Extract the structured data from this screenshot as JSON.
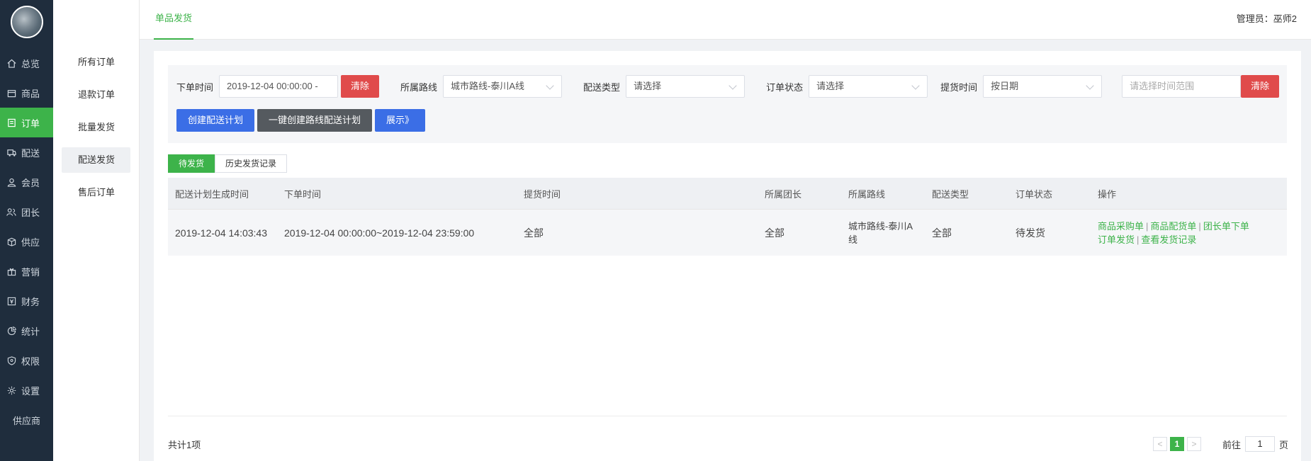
{
  "sidebar": {
    "items": [
      {
        "label": "总览",
        "icon": "home-icon"
      },
      {
        "label": "商品",
        "icon": "box-icon"
      },
      {
        "label": "订单",
        "icon": "order-icon",
        "active": true
      },
      {
        "label": "配送",
        "icon": "truck-icon"
      },
      {
        "label": "会员",
        "icon": "user-icon"
      },
      {
        "label": "团长",
        "icon": "team-icon"
      },
      {
        "label": "供应",
        "icon": "supply-icon"
      },
      {
        "label": "营销",
        "icon": "gift-icon"
      },
      {
        "label": "财务",
        "icon": "finance-icon"
      },
      {
        "label": "统计",
        "icon": "chart-icon"
      },
      {
        "label": "权限",
        "icon": "shield-icon"
      },
      {
        "label": "设置",
        "icon": "gear-icon"
      },
      {
        "label": "供应商",
        "icon": ""
      }
    ]
  },
  "submenu": {
    "items": [
      "所有订单",
      "退款订单",
      "批量发货",
      "配送发货",
      "售后订单"
    ],
    "active_index": 3
  },
  "header": {
    "tab": "单品发货",
    "admin_label": "管理员：",
    "admin_name": "巫师2"
  },
  "filters": {
    "order_time_label": "下单时间",
    "order_time_value": "2019-12-04 00:00:00 -",
    "clear_label": "清除",
    "route_label": "所属路线",
    "route_value": "城市路线-泰川A线",
    "delivery_type_label": "配送类型",
    "delivery_type_value": "请选择",
    "order_status_label": "订单状态",
    "order_status_value": "请选择",
    "pickup_time_label": "提货时间",
    "pickup_time_value": "按日期",
    "pickup_range_placeholder": "请选择时间范围",
    "clear2_label": "清除"
  },
  "actions": {
    "create_plan": "创建配送计划",
    "one_click_plan": "一键创建路线配送计划",
    "expand": "展示》"
  },
  "tabs": [
    "待发货",
    "历史发货记录"
  ],
  "table": {
    "headers": [
      "配送计划生成时间",
      "下单时间",
      "提货时间",
      "所属团长",
      "所属路线",
      "配送类型",
      "订单状态",
      "操作"
    ],
    "rows": [
      {
        "created": "2019-12-04 14:03:43",
        "order_time": "2019-12-04 00:00:00~2019-12-04 23:59:00",
        "pickup_time": "全部",
        "leader": "全部",
        "route": "城市路线-泰川A线",
        "delivery_type": "全部",
        "status": "待发货",
        "ops": [
          "商品采购单",
          "商品配货单",
          "团长单下单",
          "订单发货",
          "查看发货记录"
        ]
      }
    ]
  },
  "footer": {
    "total": "共计1项",
    "current_page": "1",
    "prev": "<",
    "next": ">",
    "goto_label": "前往",
    "goto_value": "1",
    "page_unit": "页"
  },
  "colors": {
    "accent": "#3db34a",
    "sidebar_bg": "#1f2d3d",
    "danger": "#e04b4b",
    "primary": "#3b6ee6"
  }
}
